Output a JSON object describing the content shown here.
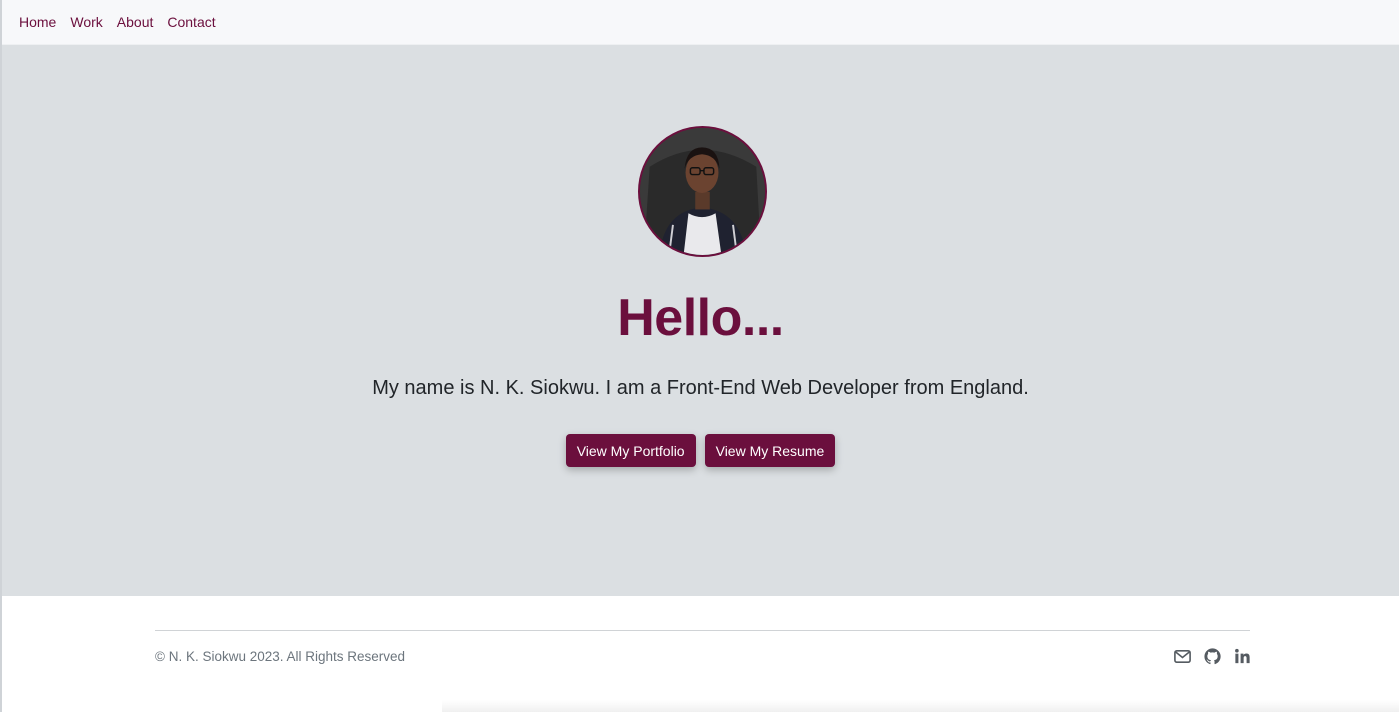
{
  "nav": {
    "items": [
      {
        "label": "Home"
      },
      {
        "label": "Work"
      },
      {
        "label": "About"
      },
      {
        "label": "Contact"
      }
    ]
  },
  "hero": {
    "heading": "Hello...",
    "intro": "My name is N. K. Siokwu. I am a Front-End Web Developer from England.",
    "buttons": {
      "portfolio": "View My Portfolio",
      "resume": "View My Resume"
    }
  },
  "footer": {
    "copyright": "© N. K. Siokwu 2023. All Rights Reserved",
    "social_icons": [
      "envelope-icon",
      "github-icon",
      "linkedin-icon"
    ]
  },
  "colors": {
    "brand": "#6b0f3d",
    "hero_bg": "#dbdfe2",
    "nav_bg": "#f7f8fa",
    "text": "#212529",
    "muted": "#6c757d"
  }
}
